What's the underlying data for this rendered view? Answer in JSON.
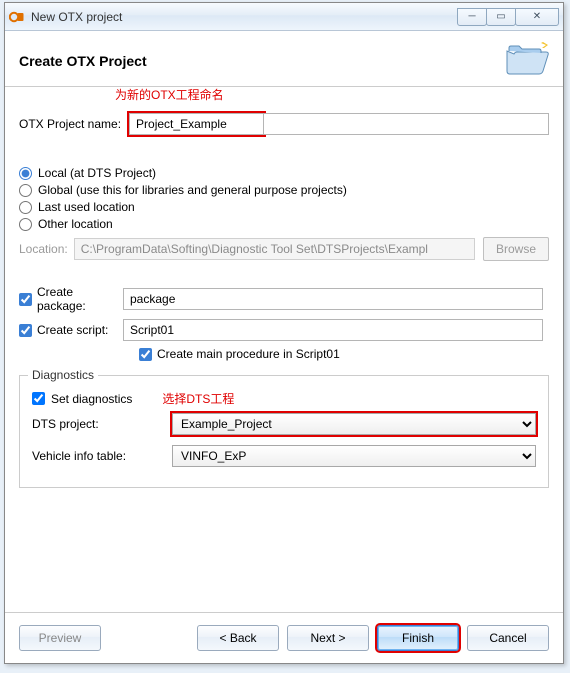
{
  "window": {
    "title": "New OTX project"
  },
  "header": {
    "title": "Create OTX Project"
  },
  "annotations": {
    "name_hint": "为新的OTX工程命名",
    "dts_hint": "选择DTS工程"
  },
  "fields": {
    "name_label": "OTX Project name:",
    "name_value": "Project_Example"
  },
  "location": {
    "radios": {
      "local": "Local (at DTS Project)",
      "global": "Global (use this for libraries and general purpose projects)",
      "last": "Last used location",
      "other": "Other location"
    },
    "label": "Location:",
    "value": "C:\\ProgramData\\Softing\\Diagnostic Tool Set\\DTSProjects\\Exampl",
    "browse": "Browse"
  },
  "package": {
    "chk_label": "Create package:",
    "value": "package"
  },
  "script": {
    "chk_label": "Create script:",
    "value": "Script01",
    "main_label": "Create main procedure in Script01"
  },
  "diagnostics": {
    "legend": "Diagnostics",
    "set_label": "Set diagnostics",
    "dts_label": "DTS project:",
    "dts_value": "Example_Project",
    "vinfo_label": "Vehicle info table:",
    "vinfo_value": "VINFO_ExP"
  },
  "footer": {
    "preview": "Preview",
    "back": "< Back",
    "next": "Next >",
    "finish": "Finish",
    "cancel": "Cancel"
  }
}
